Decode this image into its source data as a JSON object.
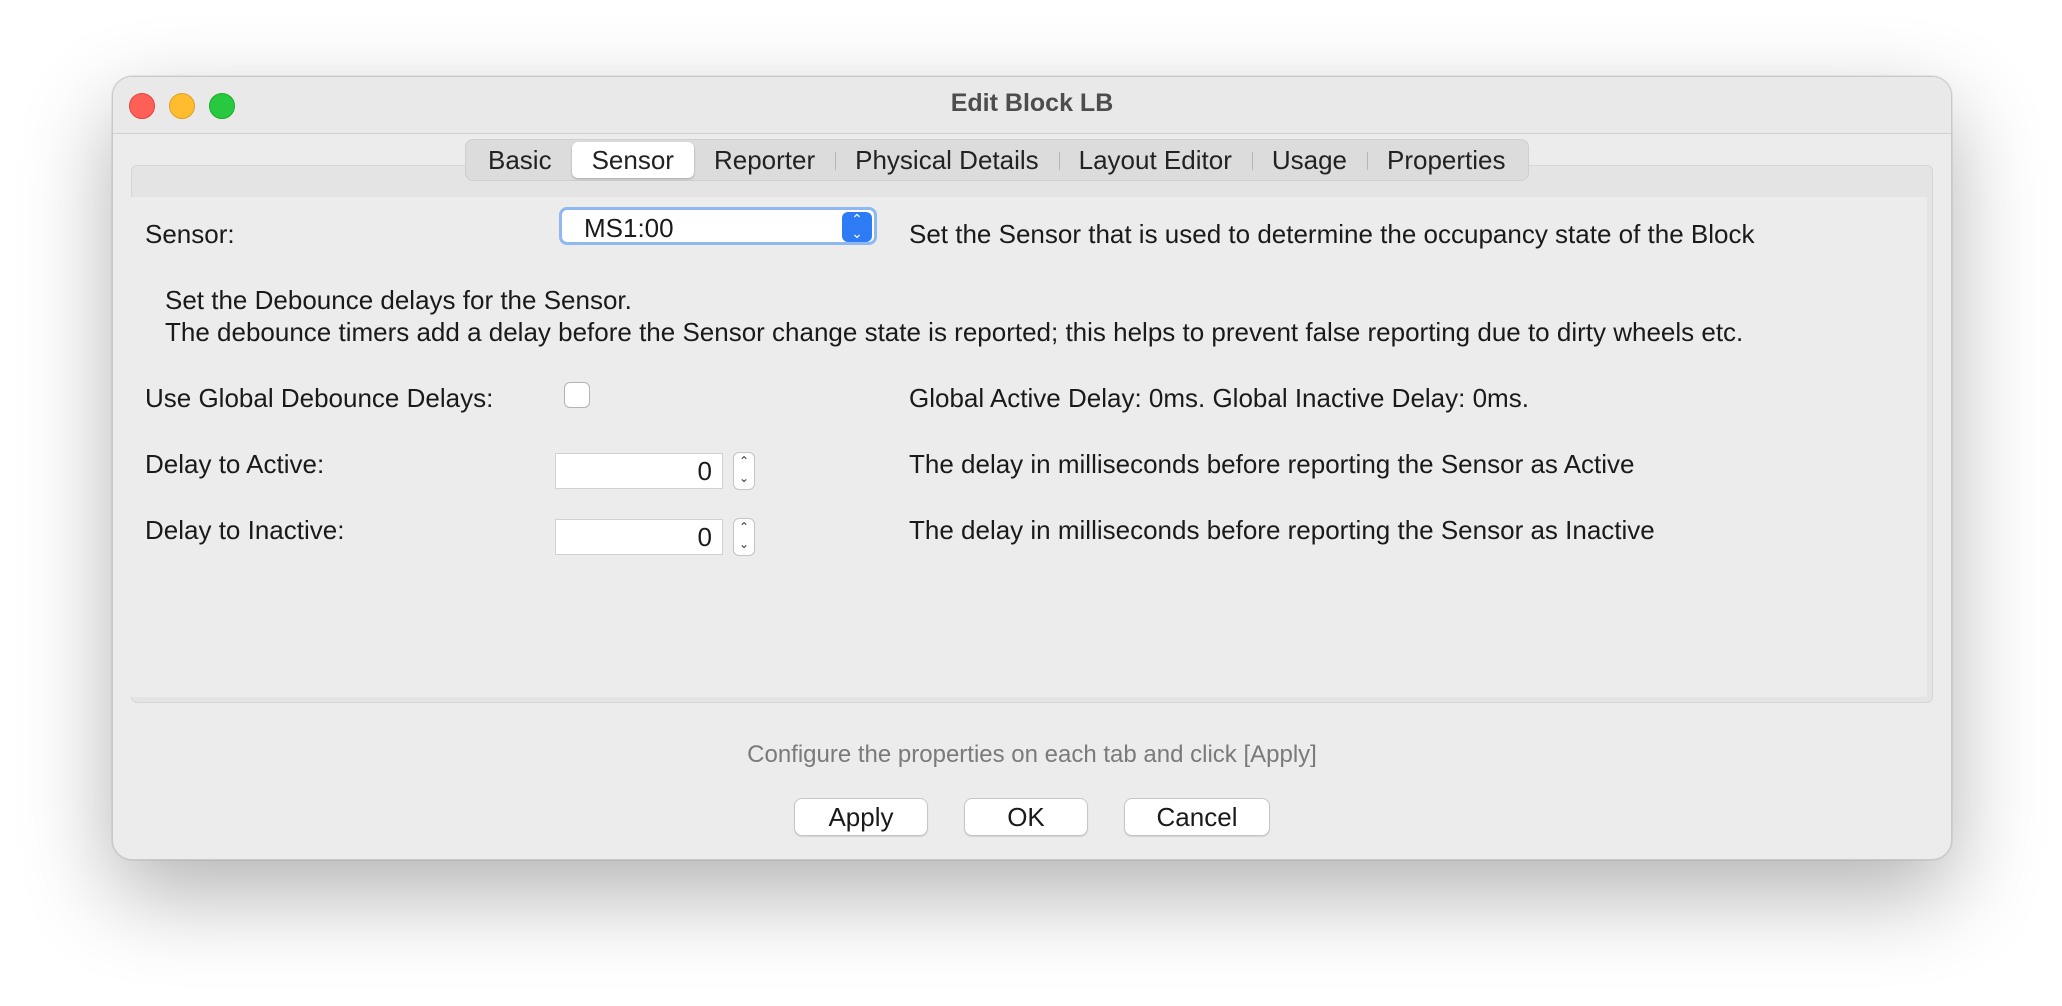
{
  "window": {
    "title": "Edit Block LB"
  },
  "tabs": [
    {
      "label": "Basic",
      "selected": false
    },
    {
      "label": "Sensor",
      "selected": true
    },
    {
      "label": "Reporter",
      "selected": false
    },
    {
      "label": "Physical Details",
      "selected": false
    },
    {
      "label": "Layout Editor",
      "selected": false
    },
    {
      "label": "Usage",
      "selected": false
    },
    {
      "label": "Properties",
      "selected": false
    }
  ],
  "sensor": {
    "label": "Sensor:",
    "selected_value": "MS1:00",
    "help": "Set the Sensor that is used to determine the occupancy state of the Block"
  },
  "debounce": {
    "heading": "Set the Debounce delays for the Sensor.",
    "description": "The debounce timers add a delay before the Sensor change state is reported; this helps to prevent false reporting due to dirty wheels etc.",
    "use_global_label": "Use Global Debounce Delays:",
    "use_global_checked": false,
    "global_info": "Global Active Delay: 0ms. Global Inactive Delay: 0ms.",
    "active_label": "Delay to Active:",
    "active_value": "0",
    "active_help": "The delay in milliseconds before reporting the Sensor as Active",
    "inactive_label": "Delay to Inactive:",
    "inactive_value": "0",
    "inactive_help": "The delay in milliseconds before reporting the Sensor as Inactive"
  },
  "footer": {
    "status": "Configure the properties on each tab and click [Apply]",
    "apply_label": "Apply",
    "ok_label": "OK",
    "cancel_label": "Cancel"
  },
  "colors": {
    "accent": "#2d7cf6",
    "focus_ring": "#8fb7f0",
    "close": "#fe5f57",
    "minimize": "#febc2e",
    "zoom": "#28c840"
  }
}
